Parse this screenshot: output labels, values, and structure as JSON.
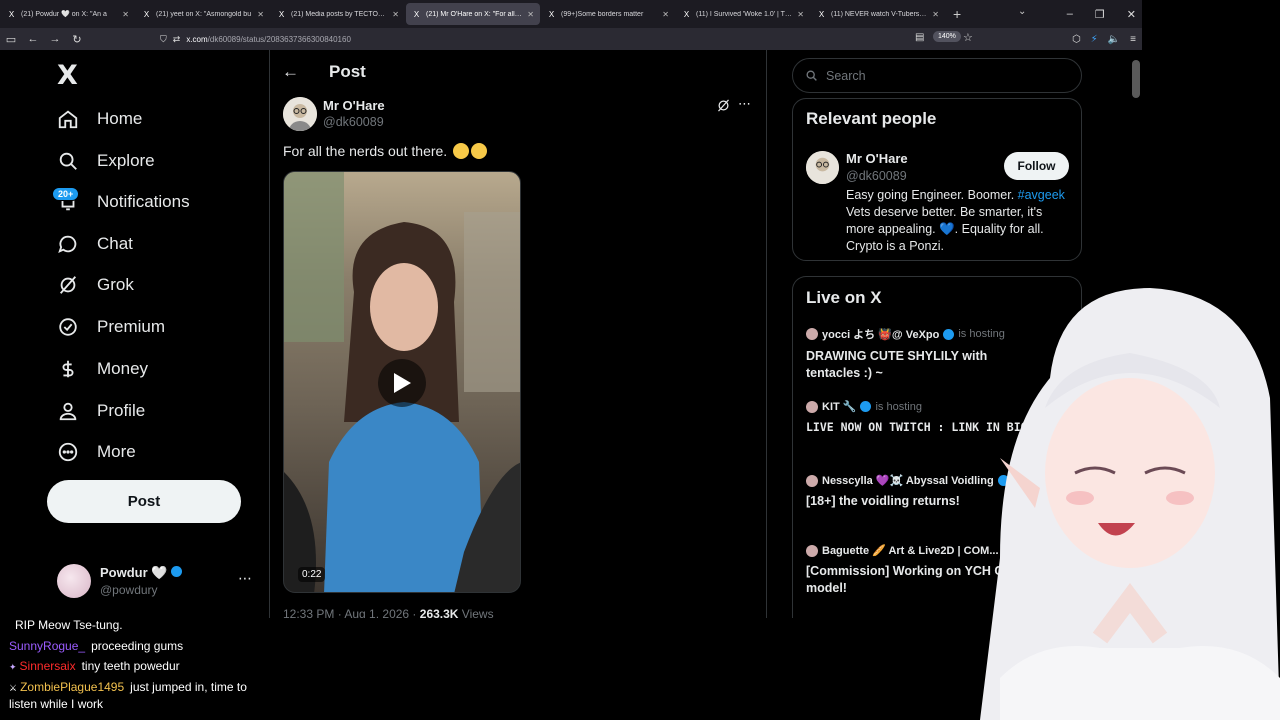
{
  "browser": {
    "tabs": [
      {
        "label": "(21) Powdur 🤍 on X: \"An a",
        "active": false
      },
      {
        "label": "(21) yeet on X: \"Asmongold bu",
        "active": false
      },
      {
        "label": "(21) Media posts by TECTONE",
        "active": false
      },
      {
        "label": "(21) Mr O'Hare on X: \"For all th",
        "active": true
      },
      {
        "label": "(99+)Some borders matter",
        "active": false
      },
      {
        "label": "(11) I Survived 'Woke 1.0' | The",
        "active": false
      },
      {
        "label": "(11) NEVER watch V-Tubers - Y",
        "active": false
      }
    ],
    "url_host": "x.com",
    "url_path": "/dk60089/status/2083637366300840160",
    "zoom": "140%"
  },
  "sidebar": {
    "logo": "X",
    "items": [
      {
        "label": "Home",
        "icon": "home-icon"
      },
      {
        "label": "Explore",
        "icon": "search-icon"
      },
      {
        "label": "Notifications",
        "icon": "bell-icon"
      },
      {
        "label": "Chat",
        "icon": "chat-icon"
      },
      {
        "label": "Grok",
        "icon": "grok-icon"
      },
      {
        "label": "Premium",
        "icon": "premium-icon"
      },
      {
        "label": "Money",
        "icon": "money-icon"
      },
      {
        "label": "Profile",
        "icon": "profile-icon"
      },
      {
        "label": "More",
        "icon": "more-icon"
      }
    ],
    "notif_badge": "20+",
    "post_button": "Post",
    "account": {
      "name": "Powdur 🤍",
      "handle": "@powdury"
    }
  },
  "post": {
    "header": "Post",
    "author_name": "Mr O'Hare",
    "author_handle": "@dk60089",
    "text": "For all the nerds out there.",
    "video_duration": "0:22",
    "time": "12:33 PM · Aug 1, 2026 · ",
    "views_count": "263.3K",
    "views_label": " Views"
  },
  "right": {
    "search_placeholder": "Search",
    "relevant_title": "Relevant people",
    "person": {
      "name": "Mr O'Hare",
      "handle": "@dk60089",
      "follow": "Follow",
      "bio_before": "Easy going Engineer. Boomer. ",
      "bio_tag": "#avgeek",
      "bio_after": " Vets deserve better. Be smarter, it's more appealing. 💙. Equality for all. Crypto is a Ponzi."
    },
    "live_title": "Live on X",
    "live": [
      {
        "host": "yocci よち 👹@ VeXpo",
        "hosting": "is hosting",
        "title": "DRAWING CUTE SHYLILY with tentacles :) ~",
        "mono": false
      },
      {
        "host": "KIT 🔧",
        "hosting": "is hosting",
        "title": "LIVE NOW ON TWITCH : LINK IN BIO",
        "mono": true
      },
      {
        "host": "Nesscylla 💜☠️ Abyssal Voidling",
        "hosting": "",
        "title": "[18+] the voidling returns!",
        "mono": false
      },
      {
        "host": "Baguette 🥖 Art & Live2D | COM...",
        "hosting": "is",
        "title": "[Commission] Working on YCH Chibi model!",
        "mono": false
      }
    ]
  },
  "chat": [
    {
      "user": "",
      "text": "RIP Meow Tse-tung.",
      "color": "#ffffff"
    },
    {
      "user": "SunnyRogue_",
      "text": "proceeding gums",
      "color": "#9b5cff"
    },
    {
      "user": "Sinnersaix",
      "text": "tiny teeth powedur",
      "color": "#ff2b2b"
    },
    {
      "user": "ZombiePlague1495",
      "text": "just jumped in, time to",
      "color": "#f2c14e"
    },
    {
      "user": "",
      "text": "listen while I work",
      "color": "#ffffff"
    }
  ]
}
